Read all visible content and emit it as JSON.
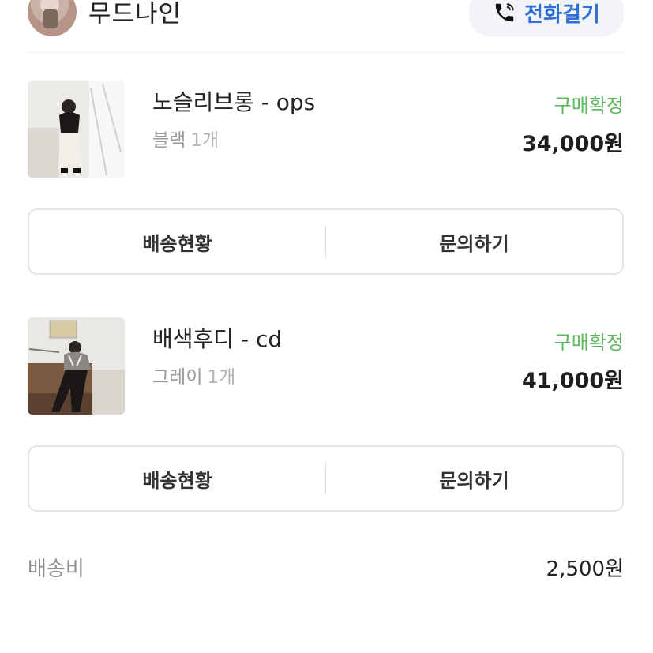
{
  "store": {
    "name": "무드나인",
    "call_label": "전화걸기",
    "call_icon": "phone-icon"
  },
  "orders": [
    {
      "name": "노슬리브롱 - ops",
      "option": "블랙",
      "quantity": "1개",
      "status": "구매확정",
      "price": "34,000원",
      "actions": {
        "shipping": "배송현황",
        "inquiry": "문의하기"
      }
    },
    {
      "name": "배색후디 - cd",
      "option": "그레이",
      "quantity": "1개",
      "status": "구매확정",
      "price": "41,000원",
      "actions": {
        "shipping": "배송현황",
        "inquiry": "문의하기"
      }
    }
  ],
  "shipping_fee": {
    "label": "배송비",
    "value": "2,500원"
  },
  "colors": {
    "status": "#5cb85c",
    "call": "#2f6fd6",
    "price": "#1f1f1f"
  }
}
